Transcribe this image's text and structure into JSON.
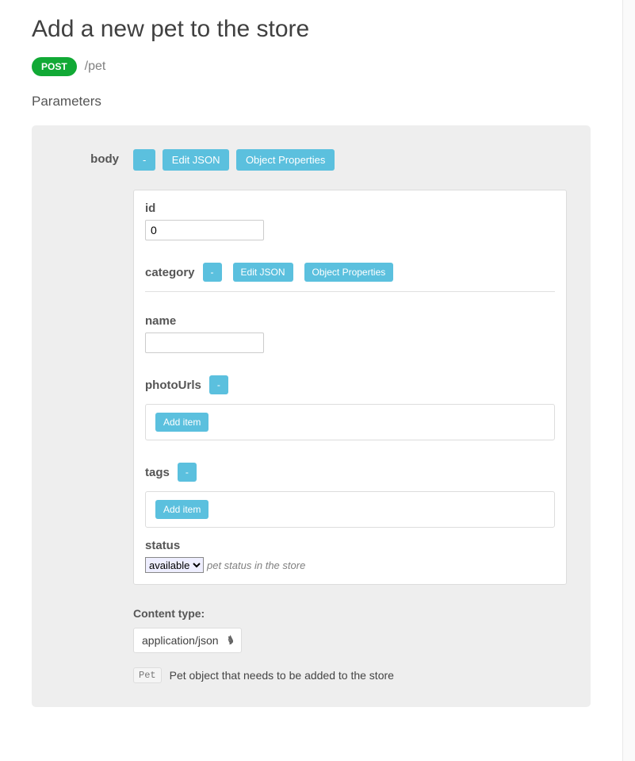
{
  "header": {
    "title": "Add a new pet to the store",
    "method": "POST",
    "path": "/pet"
  },
  "parameters_heading": "Parameters",
  "body": {
    "label": "body",
    "buttons": {
      "collapse": "-",
      "edit_json": "Edit JSON",
      "object_props": "Object Properties"
    },
    "fields": {
      "id": {
        "label": "id",
        "value": "0"
      },
      "category": {
        "label": "category",
        "buttons": {
          "collapse": "-",
          "edit_json": "Edit JSON",
          "object_props": "Object Properties"
        }
      },
      "name": {
        "label": "name",
        "value": ""
      },
      "photoUrls": {
        "label": "photoUrls",
        "buttons": {
          "collapse": "-",
          "add_item": "Add item"
        }
      },
      "tags": {
        "label": "tags",
        "buttons": {
          "collapse": "-",
          "add_item": "Add item"
        }
      },
      "status": {
        "label": "status",
        "value": "available",
        "description": "pet status in the store"
      }
    }
  },
  "content_type": {
    "label": "Content type:",
    "value": "application/json"
  },
  "description": {
    "model": "Pet",
    "text": "Pet object that needs to be added to the store"
  }
}
